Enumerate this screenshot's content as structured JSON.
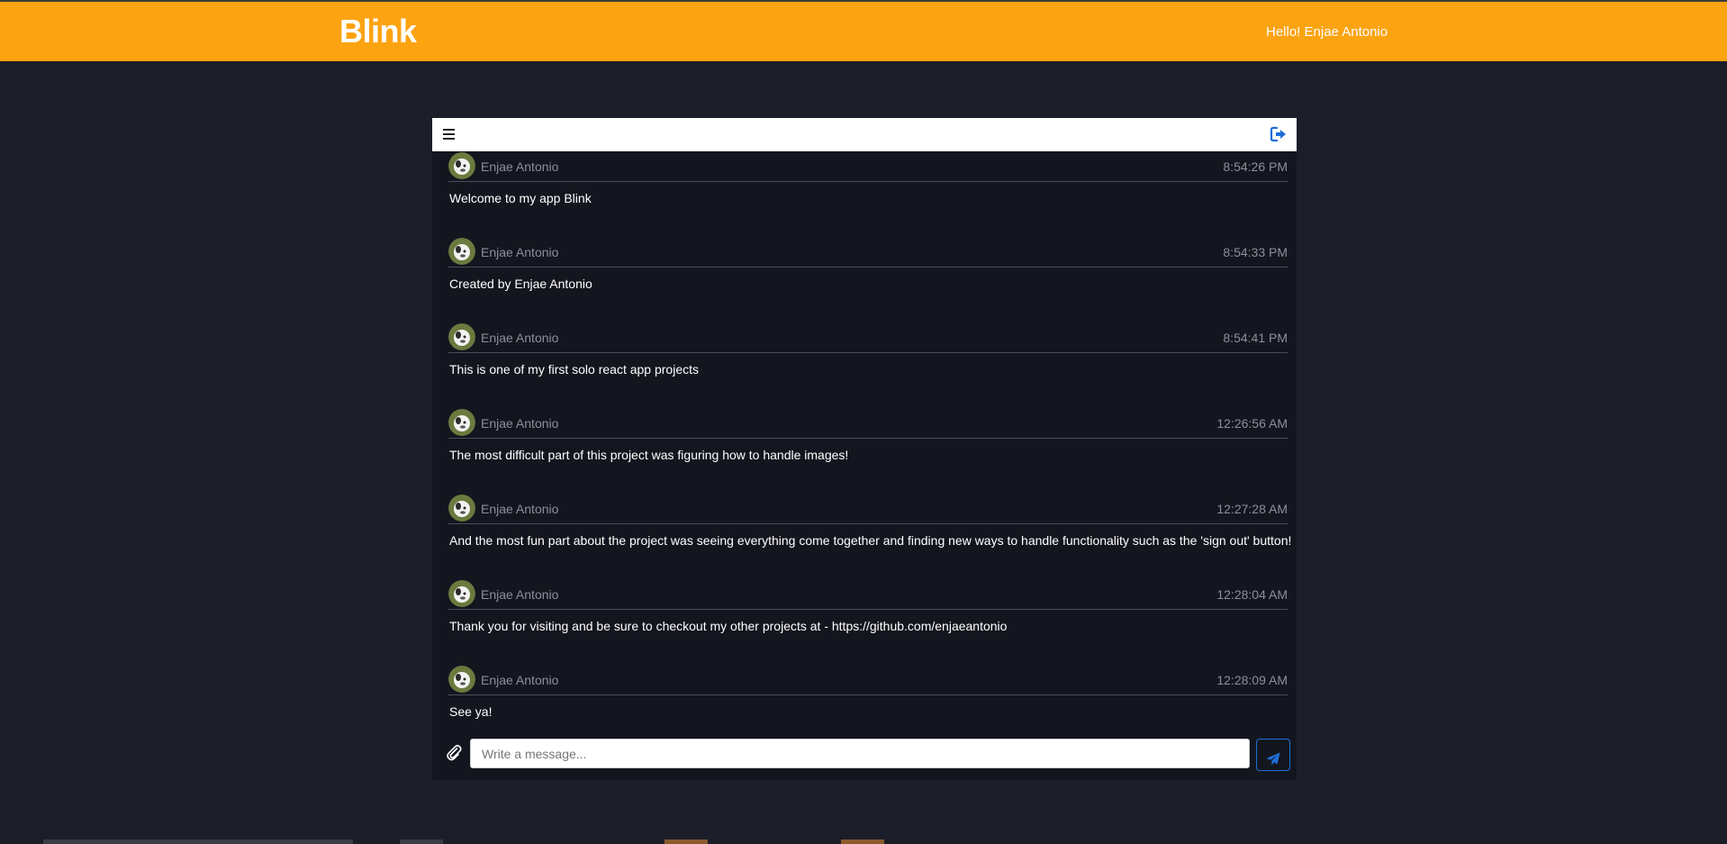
{
  "app": {
    "brand": "Blink",
    "greeting": "Hello! Enjae Antonio"
  },
  "chat_header": {
    "menu_icon": "hamburger-menu-icon",
    "signout_icon": "sign-out-icon",
    "accent_color": "#1e6fd9"
  },
  "messages": [
    {
      "author": "Enjae Antonio",
      "time": "8:54:26 PM",
      "text": "Welcome to my app Blink"
    },
    {
      "author": "Enjae Antonio",
      "time": "8:54:33 PM",
      "text": "Created by Enjae Antonio"
    },
    {
      "author": "Enjae Antonio",
      "time": "8:54:41 PM",
      "text": "This is one of my first solo react app projects"
    },
    {
      "author": "Enjae Antonio",
      "time": "12:26:56 AM",
      "text": "The most difficult part of this project was figuring how to handle images!"
    },
    {
      "author": "Enjae Antonio",
      "time": "12:27:28 AM",
      "text": "And the most fun part about the project was seeing everything come together and finding new ways to handle functionality such as the 'sign out' button!"
    },
    {
      "author": "Enjae Antonio",
      "time": "12:28:04 AM",
      "text": "Thank you for visiting and be sure to checkout my other projects at - https://github.com/enjaeantonio"
    },
    {
      "author": "Enjae Antonio",
      "time": "12:28:09 AM",
      "text": "See ya!"
    }
  ],
  "composer": {
    "placeholder": "Write a message...",
    "attach_icon": "paperclip-icon",
    "send_icon": "paper-plane-icon"
  },
  "colors": {
    "header_bg": "#fca311",
    "page_bg": "#1b1d29",
    "panel_bg": "#14161f"
  }
}
